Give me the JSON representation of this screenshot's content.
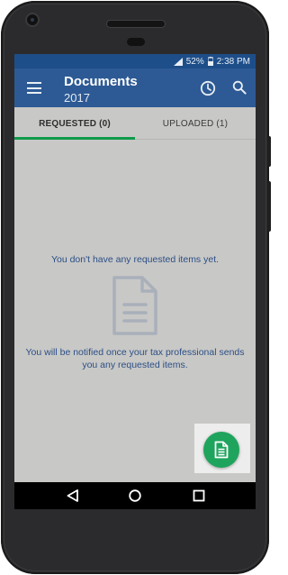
{
  "status_bar": {
    "battery": "52%",
    "time": "2:38 PM"
  },
  "app_bar": {
    "title": "Documents",
    "subtitle": "2017"
  },
  "tabs": [
    {
      "label": "REQUESTED (0)",
      "active": true
    },
    {
      "label": "UPLOADED (1)",
      "active": false
    }
  ],
  "empty_state": {
    "title": "You don't have any requested items yet.",
    "message": "You will be notified once your tax professional sends you any requested items."
  },
  "icons": {
    "menu": "hamburger-menu-icon",
    "history": "clock-icon",
    "search": "search-icon",
    "empty": "document-icon",
    "fab": "document-icon",
    "nav_back": "back-triangle-icon",
    "nav_home": "home-circle-icon",
    "nav_recent": "recent-apps-square-icon"
  },
  "colors": {
    "app_bar": "#2d5a94",
    "status_bar": "#1d4e89",
    "tab_indicator": "#0f9b4a",
    "fab": "#1fa45d",
    "body_text": "#2c4f86",
    "screen_background": "#c8c8c6"
  }
}
